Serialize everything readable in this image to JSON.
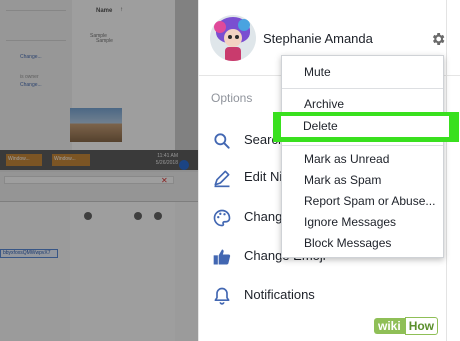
{
  "background_screen": {
    "column_header": "Name",
    "sort_arrow": "↑",
    "sample_1": "Sample",
    "sample_2": "Sample",
    "change_1": "Change...",
    "change_2": "Change...",
    "owner_text": "is owner",
    "taskbar_item_1": "Window...",
    "taskbar_item_2": "Window...",
    "clock_time": "11:41 AM",
    "clock_date": "5/26/2018",
    "link_text": "bbyxfoxsQMWwpvX7"
  },
  "profile": {
    "name": "Stephanie Amanda"
  },
  "options": {
    "label": "Options",
    "items": [
      {
        "label": "Search",
        "icon": "search-icon"
      },
      {
        "label": "Edit Nicknames",
        "icon": "pencil-icon"
      },
      {
        "label": "Change Color",
        "icon": "palette-icon"
      },
      {
        "label": "Change Emoji",
        "icon": "thumbs-up-icon"
      },
      {
        "label": "Notifications",
        "icon": "bell-icon"
      }
    ]
  },
  "menu": {
    "items": [
      "Mute",
      "Archive",
      "Delete",
      "Mark as Unread",
      "Mark as Spam",
      "Report Spam or Abuse...",
      "Ignore Messages",
      "Block Messages"
    ],
    "highlighted": "Delete"
  },
  "colors": {
    "highlight": "#39e01e",
    "messenger_blue": "#4267b2"
  },
  "watermark": {
    "wiki": "wiki",
    "how": "How"
  }
}
